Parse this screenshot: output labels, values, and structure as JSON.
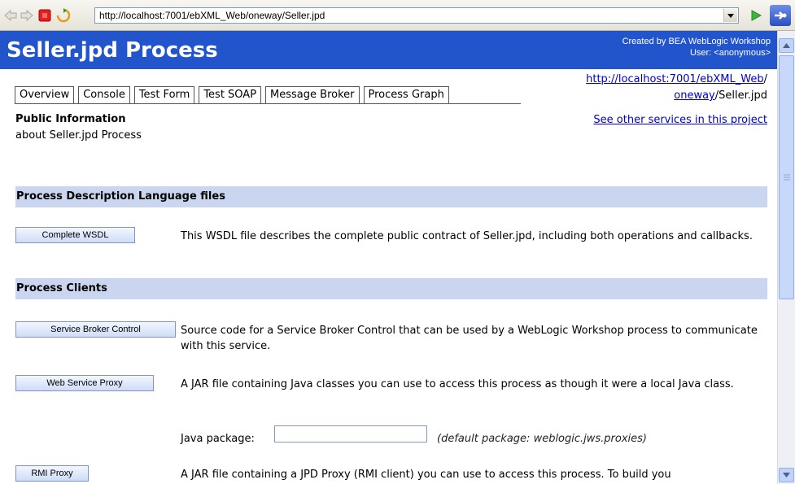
{
  "browser": {
    "url": "http://localhost:7001/ebXML_Web/oneway/Seller.jpd"
  },
  "header": {
    "title": "Seller.jpd Process",
    "created_by": "Created by BEA WebLogic Workshop",
    "user": "User: <anonymous>"
  },
  "tabs": [
    "Overview",
    "Console",
    "Test Form",
    "Test SOAP",
    "Message Broker",
    "Process Graph"
  ],
  "path": {
    "line1_link": "http://localhost:7001/",
    "line1_link2": "ebXML_Web",
    "line1_slash": "/",
    "line2_link": "oneway",
    "line2_rest": "/Seller.jpd"
  },
  "public_info": {
    "title": "Public Information",
    "subtitle": "about Seller.jpd Process",
    "other_services_link": "See other services in this project"
  },
  "sections": {
    "pdl_title": "Process Description Language files",
    "clients_title": "Process Clients"
  },
  "actions": {
    "complete_wsdl": {
      "label": "Complete WSDL",
      "desc": "This WSDL file describes the complete public contract of Seller.jpd, including both operations and callbacks."
    },
    "service_broker": {
      "label": "Service Broker Control",
      "desc": "Source code for a Service Broker Control that can be used by a WebLogic Workshop process to communicate with this service."
    },
    "web_service_proxy": {
      "label": "Web Service Proxy",
      "desc": "A JAR file containing Java classes you can use to access this process as though it were a local Java class."
    },
    "rmi_proxy": {
      "label": "RMI Proxy",
      "desc": "A JAR file containing a JPD Proxy (RMI client) you can use to access this process. To build you"
    }
  },
  "java_package": {
    "label": "Java package:",
    "value": "",
    "hint": "(default package: weblogic.jws.proxies)"
  }
}
